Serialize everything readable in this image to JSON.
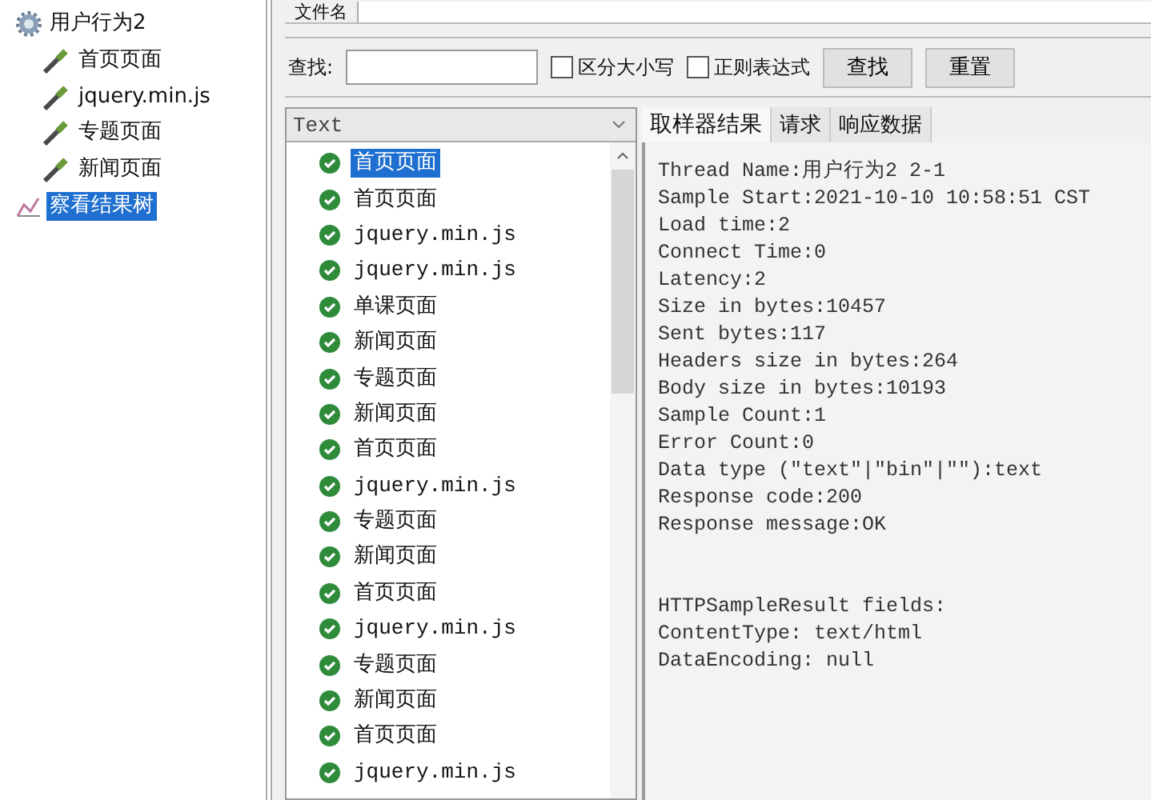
{
  "top_field": {
    "label": "文件名"
  },
  "tree": {
    "items": [
      {
        "label": "用户行为2",
        "kind": "thread",
        "selected": false,
        "children": [
          {
            "label": "首页页面",
            "kind": "sampler",
            "selected": false
          },
          {
            "label": "jquery.min.js",
            "kind": "sampler",
            "selected": false
          },
          {
            "label": "专题页面",
            "kind": "sampler",
            "selected": false
          },
          {
            "label": "新闻页面",
            "kind": "sampler",
            "selected": false
          }
        ]
      },
      {
        "label": "察看结果树",
        "kind": "listener",
        "selected": true
      }
    ]
  },
  "search": {
    "label": "查找:",
    "checkboxes": [
      {
        "label": "区分大小写",
        "checked": false
      },
      {
        "label": "正则表达式",
        "checked": false
      }
    ],
    "buttons": [
      "查找",
      "重置"
    ]
  },
  "renderer": {
    "value": "Text"
  },
  "results": [
    {
      "label": "首页页面",
      "selected": true
    },
    {
      "label": "首页页面",
      "selected": false
    },
    {
      "label": "jquery.min.js",
      "selected": false
    },
    {
      "label": "jquery.min.js",
      "selected": false
    },
    {
      "label": "单课页面",
      "selected": false
    },
    {
      "label": "新闻页面",
      "selected": false
    },
    {
      "label": "专题页面",
      "selected": false
    },
    {
      "label": "新闻页面",
      "selected": false
    },
    {
      "label": "首页页面",
      "selected": false
    },
    {
      "label": "jquery.min.js",
      "selected": false
    },
    {
      "label": "专题页面",
      "selected": false
    },
    {
      "label": "新闻页面",
      "selected": false
    },
    {
      "label": "首页页面",
      "selected": false
    },
    {
      "label": "jquery.min.js",
      "selected": false
    },
    {
      "label": "专题页面",
      "selected": false
    },
    {
      "label": "新闻页面",
      "selected": false
    },
    {
      "label": "首页页面",
      "selected": false
    },
    {
      "label": "jquery.min.js",
      "selected": false
    }
  ],
  "detail_tabs": [
    {
      "label": "取样器结果",
      "selected": true
    },
    {
      "label": "请求",
      "selected": false
    },
    {
      "label": "响应数据",
      "selected": false
    }
  ],
  "detail": [
    [
      "Thread Name:用户行为2 2-1",
      "Sample Start:2021-10-10 10:58:51 CST",
      "Load time:2",
      "Connect Time:0",
      "Latency:2",
      "Size in bytes:10457",
      "Sent bytes:117",
      "Headers size in bytes:264",
      "Body size in bytes:10193",
      "Sample Count:1",
      "Error Count:0",
      "Data type (\"text\"|\"bin\"|\"\"):text",
      "Response code:200",
      "Response message:OK"
    ],
    [
      "HTTPSampleResult fields:",
      "ContentType: text/html",
      "DataEncoding: null"
    ]
  ]
}
